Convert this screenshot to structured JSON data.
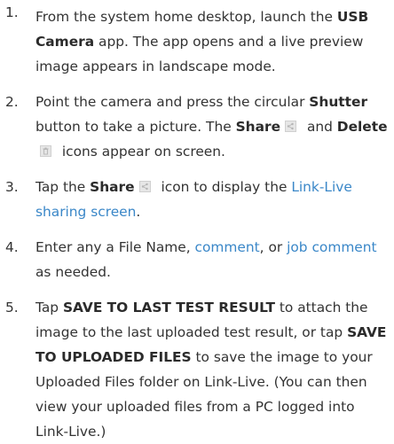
{
  "steps": [
    {
      "number": "1.",
      "t1": "From the system home desktop, launch the ",
      "b1": "USB Camera",
      "t2": " app. The app opens and a live preview image appears in landscape mode."
    },
    {
      "number": "2.",
      "t1": "Point the camera and press the circular ",
      "b1": "Shutter",
      "t2": " button to take a picture. The ",
      "b2": "Share",
      "t3": " and ",
      "b3": "Delete",
      "t4": " icons appear on screen."
    },
    {
      "number": "3.",
      "t1": "Tap the ",
      "b1": "Share",
      "t2": " icon to display the ",
      "link1": "Link-Live sharing screen",
      "t3": "."
    },
    {
      "number": "4.",
      "t1": "Enter any a File Name, ",
      "link1": "comment",
      "t2": ", or ",
      "link2": "job comment",
      "t3": " as needed."
    },
    {
      "number": "5.",
      "t1": "Tap ",
      "b1": "SAVE TO LAST TEST RESULT",
      "t2": " to attach the image to the last uploaded test result, or tap ",
      "b2": "SAVE TO UPLOADED FILES",
      "t3": " to save the image to your Uploaded Files folder on Link-Live. (You can then view your uploaded files from a PC logged into Link-Live.)"
    }
  ],
  "icons": {
    "share": "share-icon",
    "delete": "delete-icon"
  },
  "colors": {
    "text": "#333333",
    "link": "#3a87c8"
  }
}
